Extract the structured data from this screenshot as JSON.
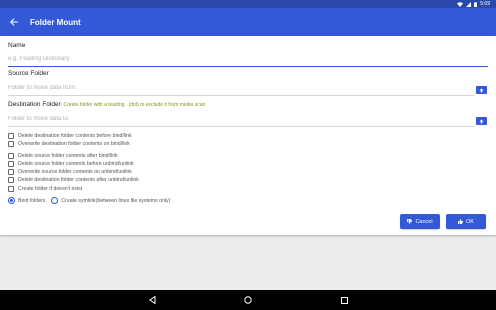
{
  "status_bar": {
    "time": "5:09",
    "icons": [
      "wifi-icon",
      "signal-icon",
      "battery-icon"
    ]
  },
  "app_bar": {
    "title": "Folder Mount",
    "back_icon": "arrow-back-icon"
  },
  "form": {
    "name": {
      "label": "Name",
      "placeholder": "e.g. Floating Dictionary",
      "value": ""
    },
    "source": {
      "label": "Source Folder",
      "placeholder": "Folder to move data from",
      "value": "",
      "icon": "folder-upload-icon"
    },
    "destination": {
      "label": "Destination Folder",
      "hint": ": Create folder with a leading . (dot) to exclude it from media scan",
      "placeholder": "Folder to move data to",
      "value": "",
      "icon": "folder-upload-icon"
    }
  },
  "options": [
    {
      "label": "Delete destination folder contents before bind/link",
      "checked": false
    },
    {
      "label": "Overwrite destination folder contents on bind/link",
      "checked": false
    },
    {
      "label": "Delete source folder contents after bind/link",
      "checked": false
    },
    {
      "label": "Delete source folder contents before unbind/unlink",
      "checked": false
    },
    {
      "label": "Overwrite source folder contents on unbind/unlink",
      "checked": false
    },
    {
      "label": "Delete destination folder contents after unbind/unlink",
      "checked": false
    },
    {
      "label": "Create folder if doesn't exist",
      "checked": false
    }
  ],
  "mount_type": {
    "options": [
      {
        "label": "Bind folders",
        "selected": true
      },
      {
        "label": "Create symlink(between linux file systems only)",
        "selected": false
      }
    ]
  },
  "actions": {
    "cancel": {
      "label": "Cancel",
      "icon": "thumb-down-icon"
    },
    "ok": {
      "label": "OK",
      "icon": "thumb-up-icon"
    }
  },
  "colors": {
    "primary": "#3459d6",
    "status_bar": "#2a48a8",
    "hint": "#7a9a1a"
  }
}
